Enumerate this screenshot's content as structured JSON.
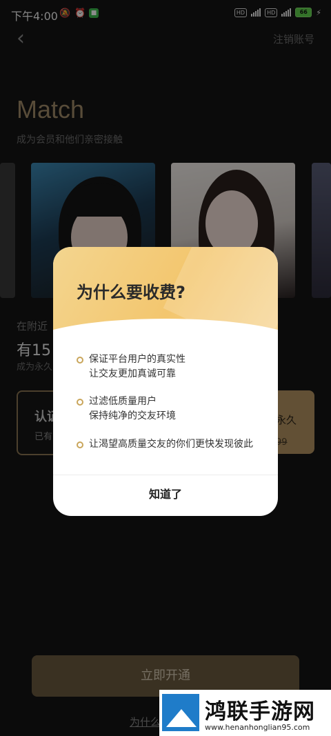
{
  "status_bar": {
    "time": "下午4:00",
    "battery": "66"
  },
  "nav": {
    "cancel_account": "注销账号"
  },
  "header": {
    "title": "Match",
    "subtitle": "成为会员和他们亲密接触"
  },
  "section": {
    "nearby": "在附近",
    "count_visible": "有15",
    "forever_visible": "成为永久"
  },
  "plan_left": {
    "title_visible": "认证",
    "sub_visible": "已有"
  },
  "plan_right": {
    "title_visible": "永久",
    "old_price_visible": "99"
  },
  "open_button": "立即开通",
  "why_link_visible": "为什么",
  "modal": {
    "title": "为什么要收费?",
    "reasons": [
      {
        "lines": [
          "保证平台用户的真实性",
          "让交友更加真诚可靠"
        ]
      },
      {
        "lines": [
          "过滤低质量用户",
          "保持纯净的交友环境"
        ]
      },
      {
        "lines": [
          "让渴望高质量交友的你们更快发现彼此"
        ]
      }
    ],
    "ok": "知道了"
  },
  "watermark": {
    "title": "鸿联手游网",
    "url": "www.henanhonglian95.com"
  },
  "colors": {
    "accent_gold": "#b39362",
    "modal_head": "#f3c66e",
    "background": "#141414"
  }
}
